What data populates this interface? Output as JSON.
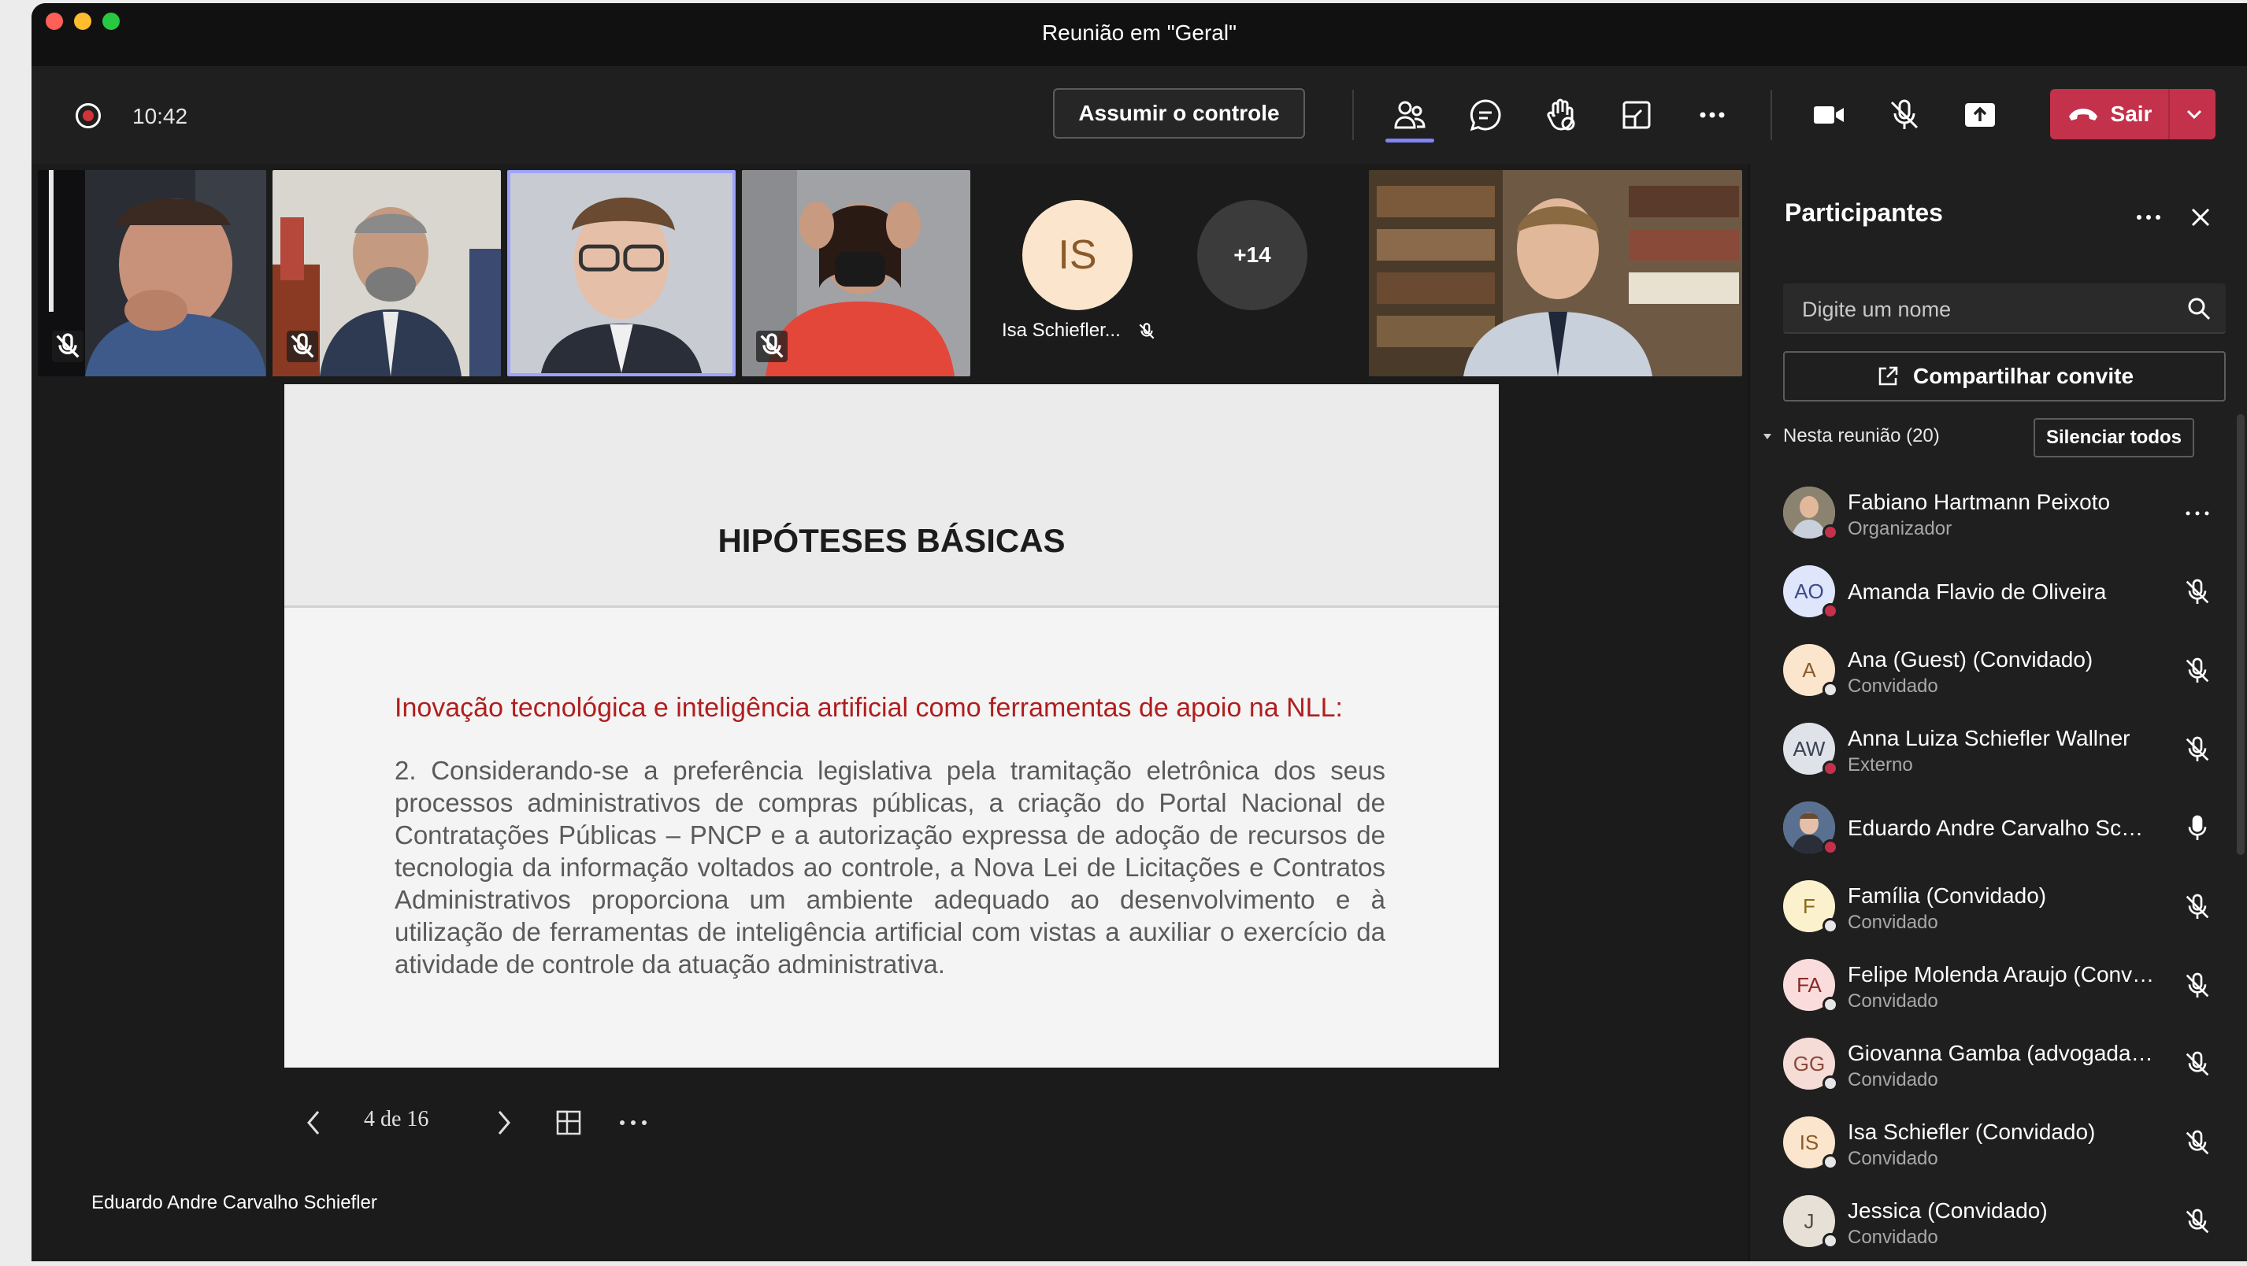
{
  "window": {
    "title": "Reunião em \"Geral\""
  },
  "toolbar": {
    "timer": "10:42",
    "take_control_label": "Assumir o controle",
    "leave_label": "Sair",
    "icons": [
      "people-icon",
      "chat-icon",
      "raise-hand-icon",
      "view-icon",
      "more-icon",
      "camera-icon",
      "mic-muted-icon",
      "share-icon",
      "phone-hangup-icon",
      "chevron-down-icon"
    ]
  },
  "stage": {
    "overflow_count": "+14",
    "isa_initials": "IS",
    "isa_name": "Isa Schiefler...",
    "presenter": "Eduardo Andre Carvalho Schiefler"
  },
  "slide": {
    "title": "HIPÓTESES BÁSICAS",
    "subtitle": "Inovação tecnológica e inteligência artificial como ferramentas de apoio na NLL:",
    "body": "2. Considerando-se a preferência legislativa pela tramitação eletrônica dos seus processos administrativos de compras públicas, a criação do Portal Nacional de Contratações Públicas – PNCP e a autorização expressa de adoção de recursos de tecnologia da informação voltados ao controle, a Nova Lei de Licitações e Contratos Administrativos proporciona um ambiente adequado ao desenvolvimento e à utilização de ferramentas de inteligência artificial com vistas a auxiliar o exercício da atividade de controle da atuação administrativa.",
    "page_indicator": "4 de 16"
  },
  "panel": {
    "title": "Participantes",
    "search_placeholder": "Digite um nome",
    "invite_label": "Compartilhar convite",
    "section_label": "Nesta reunião (20)",
    "mute_all_label": "Silenciar todos",
    "participants": [
      {
        "initials": "",
        "name": "Fabiano Hartmann Peixoto",
        "role": "Organizador"
      },
      {
        "initials": "AO",
        "name": "Amanda Flavio de Oliveira",
        "role": ""
      },
      {
        "initials": "A",
        "name": "Ana (Guest) (Convidado)",
        "role": "Convidado"
      },
      {
        "initials": "AW",
        "name": "Anna Luiza Schiefler Wallner",
        "role": "Externo"
      },
      {
        "initials": "",
        "name": "Eduardo Andre Carvalho Schi...",
        "role": ""
      },
      {
        "initials": "F",
        "name": "Família (Convidado)",
        "role": "Convidado"
      },
      {
        "initials": "FA",
        "name": "Felipe Molenda Araujo (Convi...",
        "role": "Convidado"
      },
      {
        "initials": "GG",
        "name": "Giovanna Gamba (advogada) ...",
        "role": "Convidado"
      },
      {
        "initials": "IS",
        "name": "Isa Schiefler (Convidado)",
        "role": "Convidado"
      },
      {
        "initials": "J",
        "name": "Jessica (Convidado)",
        "role": "Convidado"
      }
    ]
  },
  "colors": {
    "leave_red": "#c4314b",
    "accent": "#7f85f5",
    "slide_red": "#b01e1e",
    "busy_red": "#c4314b"
  }
}
